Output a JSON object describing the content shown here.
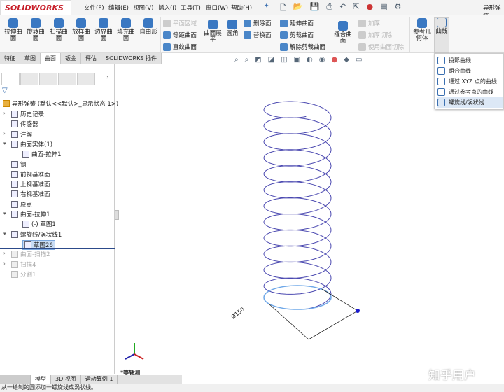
{
  "app": {
    "logo": "SOLIDWORKS",
    "doc_title": "异形弹簧"
  },
  "menu": [
    "文件(F)",
    "编辑(E)",
    "视图(V)",
    "插入(I)",
    "工具(T)",
    "窗口(W)",
    "帮助(H)"
  ],
  "ribbon": {
    "big": [
      "拉伸曲面",
      "旋转曲面",
      "扫描曲面",
      "放样曲面",
      "边界曲面",
      "填充曲面",
      "自由形"
    ],
    "col1": [
      "平面区域",
      "等距曲面",
      "直纹曲面"
    ],
    "unfold": "曲面展平",
    "fillet": "圆角",
    "col2": [
      "删除面",
      "替换面"
    ],
    "col3": [
      "延伸曲面",
      "剪裁曲面",
      "解除剪裁曲面"
    ],
    "knit": "缝合曲面",
    "col4": [
      "加厚",
      "加厚切除",
      "使用曲面切除"
    ],
    "refgeo": "参考几何体",
    "curves": "曲线"
  },
  "tabs": [
    "特征",
    "草图",
    "曲面",
    "钣金",
    "评估",
    "SOLIDWORKS 插件"
  ],
  "active_tab": "曲面",
  "flyout": [
    "投影曲线",
    "组合曲线",
    "通过 XYZ 点的曲线",
    "通过参考点的曲线",
    "螺旋线/涡状线"
  ],
  "tree": {
    "root": "异形弹簧 (默认<<默认>_显示状态 1>)",
    "items": [
      "历史记录",
      "传感器",
      "注解",
      "曲面实体(1)",
      "曲面-拉伸1",
      "钢",
      "前视基准面",
      "上视基准面",
      "右视基准面",
      "原点",
      "曲面-拉伸1",
      "(-) 草图1",
      "螺旋线/涡状线1",
      "草图26",
      "曲面-扫描2",
      "扫描4",
      "分割1"
    ]
  },
  "viewport": {
    "dimension": "Ø150",
    "view_label": "*等轴测",
    "helix_turns": 12,
    "helix_color": "#4a48b0",
    "base_color": "#6fa8e8",
    "watermark": "知乎用户"
  },
  "bottom_tabs": [
    "模型",
    "3D 视图",
    "运动算例 1"
  ],
  "status": "从一绘制的圆添加一螺旋线或涡状线。"
}
